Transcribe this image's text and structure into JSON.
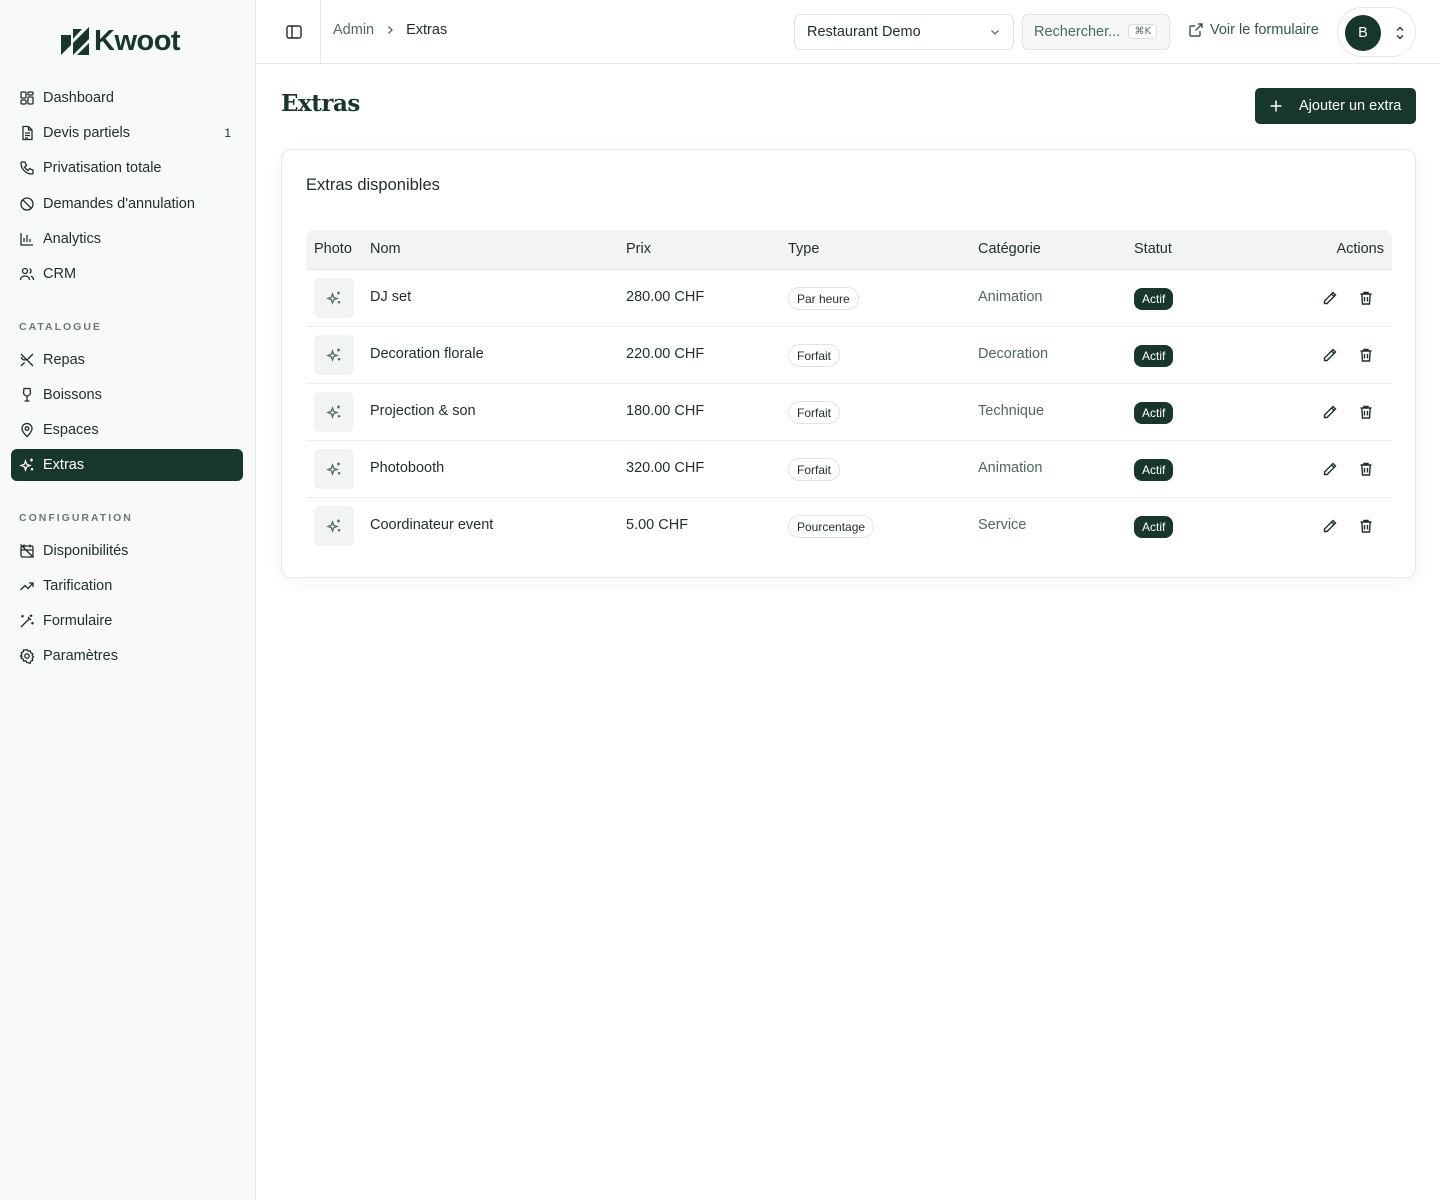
{
  "brand": {
    "name": "Kwoot"
  },
  "sidebar": {
    "items": [
      {
        "label": "Dashboard",
        "icon": "dashboard-icon"
      },
      {
        "label": "Devis partiels",
        "icon": "document-icon",
        "badge": "1"
      },
      {
        "label": "Privatisation totale",
        "icon": "phone-icon"
      },
      {
        "label": "Demandes d'annulation",
        "icon": "ban-icon"
      },
      {
        "label": "Analytics",
        "icon": "bar-chart-icon"
      },
      {
        "label": "CRM",
        "icon": "users-icon"
      }
    ],
    "catalogue_label": "CATALOGUE",
    "catalogue": [
      {
        "label": "Repas",
        "icon": "utensils-icon"
      },
      {
        "label": "Boissons",
        "icon": "wine-icon"
      },
      {
        "label": "Espaces",
        "icon": "map-pin-icon"
      },
      {
        "label": "Extras",
        "icon": "sparkles-icon",
        "active": true
      }
    ],
    "config_label": "CONFIGURATION",
    "config": [
      {
        "label": "Disponibilités",
        "icon": "calendar-off-icon"
      },
      {
        "label": "Tarification",
        "icon": "trending-up-icon"
      },
      {
        "label": "Formulaire",
        "icon": "magic-wand-icon"
      },
      {
        "label": "Paramètres",
        "icon": "gear-icon"
      }
    ]
  },
  "topbar": {
    "breadcrumb_root": "Admin",
    "breadcrumb_current": "Extras",
    "restaurant_select": "Restaurant Demo",
    "search_placeholder": "Rechercher...",
    "search_shortcut": "⌘K",
    "view_form": "Voir le formulaire",
    "avatar_initial": "B"
  },
  "page": {
    "title": "Extras",
    "add_button": "Ajouter un extra",
    "card_title": "Extras disponibles"
  },
  "table": {
    "headers": {
      "photo": "Photo",
      "name": "Nom",
      "price": "Prix",
      "type": "Type",
      "category": "Catégorie",
      "status": "Statut",
      "actions": "Actions"
    },
    "rows": [
      {
        "name": "DJ set",
        "price": "280.00 CHF",
        "type": "Par heure",
        "category": "Animation",
        "status": "Actif"
      },
      {
        "name": "Decoration florale",
        "price": "220.00 CHF",
        "type": "Forfait",
        "category": "Decoration",
        "status": "Actif"
      },
      {
        "name": "Projection & son",
        "price": "180.00 CHF",
        "type": "Forfait",
        "category": "Technique",
        "status": "Actif"
      },
      {
        "name": "Photobooth",
        "price": "320.00 CHF",
        "type": "Forfait",
        "category": "Animation",
        "status": "Actif"
      },
      {
        "name": "Coordinateur event",
        "price": "5.00 CHF",
        "type": "Pourcentage",
        "category": "Service",
        "status": "Actif"
      }
    ]
  },
  "colors": {
    "brand": "#17372c",
    "sidebar_bg": "#f7faf8",
    "muted_text": "#4d6a5e"
  }
}
